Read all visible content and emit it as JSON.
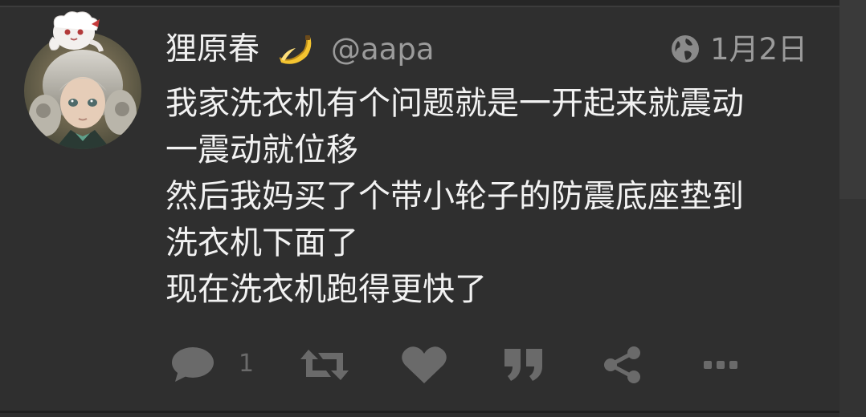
{
  "status": {
    "display_name": "狸原春",
    "display_name_emoji": "banana-icon",
    "handle": "@aapa",
    "visibility_icon": "globe-icon",
    "timestamp": "1月2日",
    "content_lines": [
      "我家洗衣机有个问题就是一开起来就震动",
      "一震动就位移",
      "然后我妈买了个带小轮子的防震底座垫到",
      "洗衣机下面了",
      "现在洗衣机跑得更快了"
    ],
    "reply_count": "1"
  },
  "actions": [
    {
      "name": "reply",
      "icon": "speech-bubble-icon"
    },
    {
      "name": "boost",
      "icon": "retweet-icon"
    },
    {
      "name": "favourite",
      "icon": "heart-icon"
    },
    {
      "name": "quote",
      "icon": "quote-icon"
    },
    {
      "name": "share",
      "icon": "share-icon"
    },
    {
      "name": "more",
      "icon": "ellipsis-icon"
    }
  ],
  "colors": {
    "background": "#2f2f2f",
    "text": "#f2f2f2",
    "muted": "#9b9b9b",
    "action_icon": "#6a6a6a",
    "emoji": "#f4c430"
  }
}
